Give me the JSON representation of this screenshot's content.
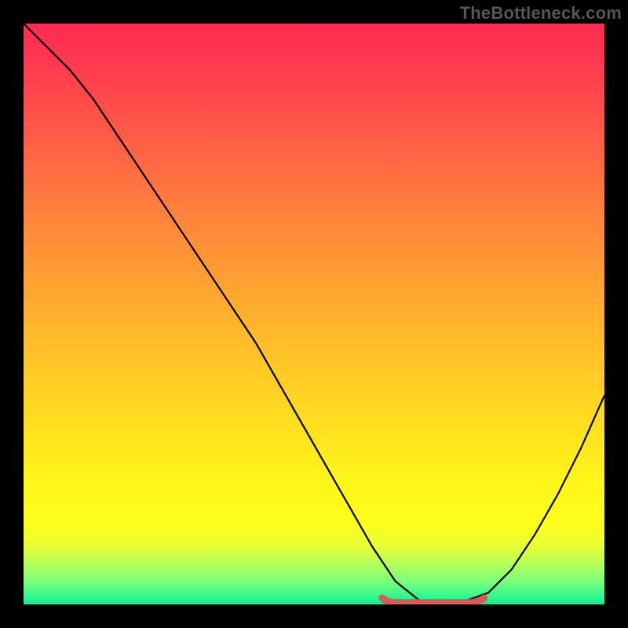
{
  "watermark": "TheBottleneck.com",
  "chart_data": {
    "type": "line",
    "title": "",
    "xlabel": "",
    "ylabel": "",
    "xlim": [
      0,
      100
    ],
    "ylim": [
      0,
      100
    ],
    "grid": false,
    "legend": false,
    "background": "red-to-green vertical heatmap gradient",
    "series": [
      {
        "name": "bottleneck-curve",
        "x": [
          0,
          4,
          8,
          12,
          16,
          20,
          24,
          28,
          32,
          36,
          40,
          44,
          48,
          52,
          56,
          60,
          64,
          68,
          70,
          72,
          76,
          80,
          84,
          88,
          92,
          96,
          100
        ],
        "y": [
          100,
          96,
          92,
          87,
          81,
          75,
          69,
          63,
          57,
          51,
          45,
          38,
          31,
          24,
          17,
          10,
          4,
          0.8,
          0.3,
          0.3,
          0.6,
          2,
          6,
          12,
          19,
          27,
          36
        ]
      }
    ],
    "optimal_range": {
      "name": "optimal-range-highlight",
      "x_start": 62,
      "x_end": 79,
      "y": 0.3,
      "note": "thick salmon segment marking minimum of curve"
    }
  },
  "colors": {
    "curve": "#000000",
    "highlight": "#d85a5a",
    "page_bg": "#000000",
    "watermark": "#565656"
  }
}
